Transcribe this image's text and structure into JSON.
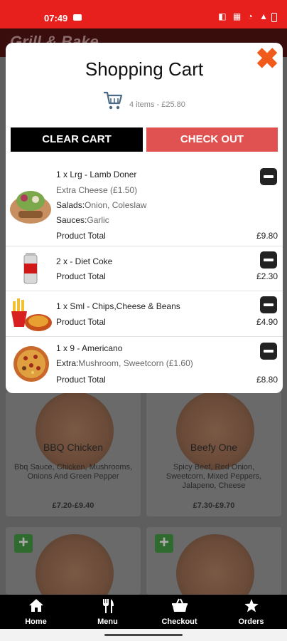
{
  "status_bar": {
    "time": "07:49",
    "icons": "◧ ▦ ◔ ▲"
  },
  "background": {
    "logo": "Grill & Bake",
    "cards": [
      {
        "name": "BBQ Chicken",
        "description": "Bbq Sauce, Chicken, Mushrooms, Onions And Green Pepper",
        "price": "£7.20-£9.40"
      },
      {
        "name": "Beefy One",
        "description": "Spicy Beef, Red Onion, Sweetcorn, Mixed Peppers, Jalapeno, Cheese",
        "price": "£7.30-£9.70"
      }
    ],
    "add_label": "+"
  },
  "modal": {
    "title": "Shopping Cart",
    "close_label": "✖",
    "summary": "4 items - £25.80",
    "clear_label": "CLEAR CART",
    "checkout_label": "CHECK OUT",
    "total_label": "Product Total",
    "items": [
      {
        "title": "1 x Lrg - Lamb Doner",
        "extra": "Extra Cheese (£1.50)",
        "salads_key": "Salads:",
        "salads_value": "Onion, Coleslaw",
        "sauces_key": "Sauces:",
        "sauces_value": "Garlic",
        "total": "£9.80"
      },
      {
        "title": "2 x - Diet Coke",
        "total": "£2.30"
      },
      {
        "title": "1 x Sml - Chips,Cheese & Beans",
        "total": "£4.90"
      },
      {
        "title": "1 x 9 - Americano",
        "extra_key": "Extra:",
        "extra_value": "Mushroom, Sweetcorn (£1.60)",
        "total": "£8.80"
      }
    ]
  },
  "nav": {
    "items": [
      {
        "label": "Home",
        "icon": "home-icon"
      },
      {
        "label": "Menu",
        "icon": "cutlery-icon"
      },
      {
        "label": "Checkout",
        "icon": "basket-icon"
      },
      {
        "label": "Orders",
        "icon": "star-icon"
      }
    ]
  },
  "colors": {
    "status_bar": "#e8201d",
    "checkout": "#e05252",
    "close": "#f05a1a"
  }
}
